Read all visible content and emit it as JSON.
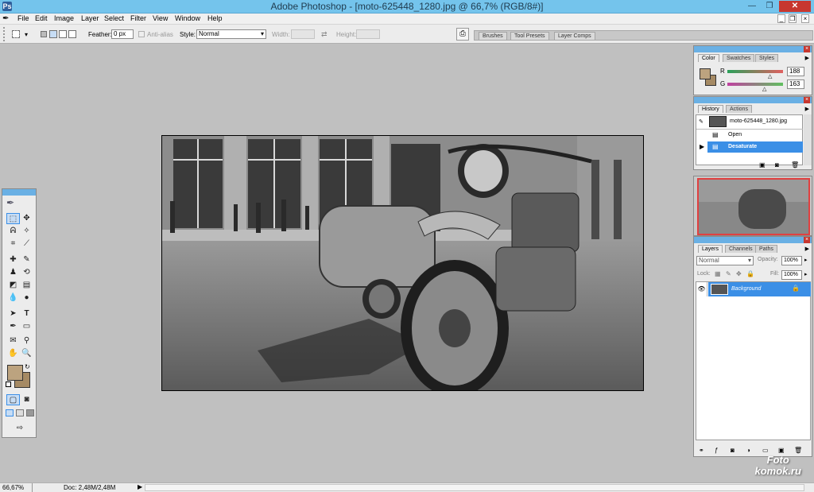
{
  "window": {
    "title": "Adobe Photoshop - [moto-625448_1280.jpg @ 66,7% (RGB/8#)]",
    "app_icon": "Ps"
  },
  "menu": [
    "File",
    "Edit",
    "Image",
    "Layer",
    "Select",
    "Filter",
    "View",
    "Window",
    "Help"
  ],
  "options": {
    "feather_label": "Feather:",
    "feather_value": "0 px",
    "antialias_label": "Anti-alias",
    "style_label": "Style:",
    "style_value": "Normal",
    "width_label": "Width:",
    "height_label": "Height:"
  },
  "palette_well": [
    "Brushes",
    "Tool Presets",
    "Layer Comps"
  ],
  "color_panel": {
    "tabs": [
      "Color",
      "Swatches",
      "Styles"
    ],
    "r_label": "R",
    "r_value": "188",
    "g_label": "G",
    "g_value": "163",
    "fg_color": "#bca37f",
    "bg_color": "#a58a64"
  },
  "history_panel": {
    "tabs": [
      "History",
      "Actions"
    ],
    "snapshot": "moto-625448_1280.jpg",
    "items": [
      "Open",
      "Desaturate"
    ],
    "selected": "Desaturate"
  },
  "layers_panel": {
    "tabs": [
      "Layers",
      "Channels",
      "Paths"
    ],
    "blend_mode": "Normal",
    "opacity_label": "Opacity:",
    "opacity_value": "100%",
    "lock_label": "Lock:",
    "fill_label": "Fill:",
    "fill_value": "100%",
    "layer_name": "Background"
  },
  "status": {
    "zoom": "66,67%",
    "doc": "Doc: 2,48M/2,48M"
  },
  "watermark": {
    "line1": "Foto",
    "line2": "komok.ru"
  },
  "colors": {
    "title_bar": "#74c4ec",
    "selection": "#3b8fe6",
    "close_red": "#c7372f"
  }
}
